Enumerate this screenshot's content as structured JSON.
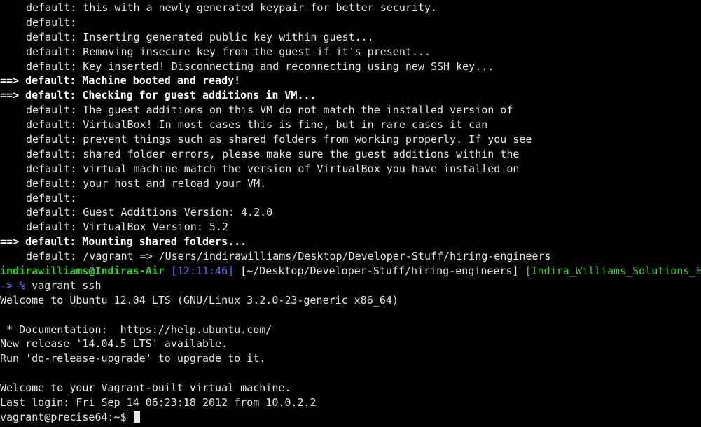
{
  "colors": {
    "background": "#000000",
    "text": "#e6e6e6",
    "user_host": "#2fd42f",
    "time": "#5f6aff",
    "branch": "#2fd42f",
    "prompt_arrow": "#6a6aff"
  },
  "terminal": {
    "lines": [
      {
        "prefix": "default:",
        "text": " this with a newly generated keypair for better security."
      },
      {
        "prefix": "default:",
        "text": ""
      },
      {
        "prefix": "default:",
        "text": " Inserting generated public key within guest..."
      },
      {
        "prefix": "default:",
        "text": " Removing insecure key from the guest if it's present..."
      },
      {
        "prefix": "default:",
        "text": " Key inserted! Disconnecting and reconnecting using new SSH key..."
      }
    ],
    "booted": {
      "arrow": "==>",
      "text": " default: Machine booted and ready!"
    },
    "checking": {
      "arrow": "==>",
      "text": " default: Checking for guest additions in VM..."
    },
    "guest_lines": [
      {
        "prefix": "default:",
        "text": " The guest additions on this VM do not match the installed version of"
      },
      {
        "prefix": "default:",
        "text": " VirtualBox! In most cases this is fine, but in rare cases it can"
      },
      {
        "prefix": "default:",
        "text": " prevent things such as shared folders from working properly. If you see"
      },
      {
        "prefix": "default:",
        "text": " shared folder errors, please make sure the guest additions within the"
      },
      {
        "prefix": "default:",
        "text": " virtual machine match the version of VirtualBox you have installed on"
      },
      {
        "prefix": "default:",
        "text": " your host and reload your VM."
      },
      {
        "prefix": "default:",
        "text": ""
      },
      {
        "prefix": "default:",
        "text": " Guest Additions Version: 4.2.0"
      },
      {
        "prefix": "default:",
        "text": " VirtualBox Version: 5.2"
      }
    ],
    "mounting": {
      "arrow": "==>",
      "text": " default: Mounting shared folders..."
    },
    "mount_line": {
      "prefix": "default:",
      "text": " /vagrant => /Users/indirawilliams/Desktop/Developer-Stuff/hiring-engineers"
    },
    "prompt": {
      "user_host": "indirawilliams@Indiras-Air",
      "time": "[12:11:46]",
      "path": "[~/Desktop/Developer-Stuff/hiring-engineers]",
      "branch": "[Indira_Williams_Solutions_E",
      "arrow": "-> %",
      "command": " vagrant ssh"
    },
    "welcome": "Welcome to Ubuntu 12.04 LTS (GNU/Linux 3.2.0-23-generic x86_64)",
    "blank1": "",
    "documentation": " * Documentation:  https://help.ubuntu.com/",
    "new_release": "New release '14.04.5 LTS' available.",
    "run_upgrade": "Run 'do-release-upgrade' to upgrade to it.",
    "blank2": "",
    "welcome_vagrant": "Welcome to your Vagrant-built virtual machine.",
    "last_login": "Last login: Fri Sep 14 06:23:18 2012 from 10.0.2.2",
    "final_prompt": "vagrant@precise64:~$ "
  }
}
